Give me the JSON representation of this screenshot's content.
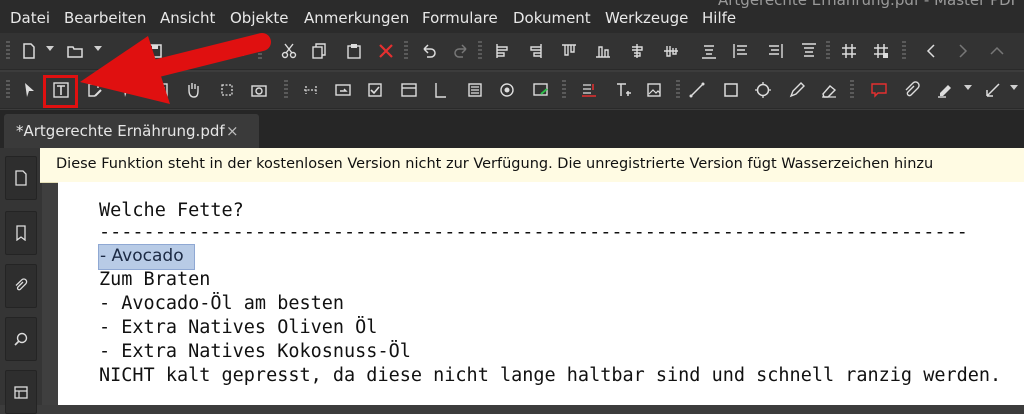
{
  "window_title": "Artgerechte Ernährung.pdf - Master PDF E",
  "menu": [
    "Datei",
    "Bearbeiten",
    "Ansicht",
    "Objekte",
    "Anmerkungen",
    "Formulare",
    "Dokument",
    "Werkzeuge",
    "Hilfe"
  ],
  "toolbar1_icons": [
    "new-document-icon",
    "open-folder-icon",
    "save-icon",
    "print-icon",
    "cut-icon",
    "copy-icon",
    "paste-icon",
    "delete-icon",
    "undo-icon",
    "redo-icon",
    "align-left-icon",
    "align-right-icon",
    "align-top-icon",
    "align-bottom-icon",
    "align-center-h-icon",
    "align-center-v-icon",
    "distribute-h-icon",
    "distribute-v-icon",
    "distribute-h2-icon",
    "distribute-v2-icon",
    "grid-icon",
    "snap-grid-icon",
    "chevron-left-icon",
    "chevron-right-icon",
    "chevron-up-icon",
    "chevron-down-icon"
  ],
  "toolbar2_icons": [
    "select-arrow-icon",
    "edit-text-icon",
    "edit-object-icon",
    "select-object-icon",
    "form-field-icon",
    "hand-tool-icon",
    "crop-icon",
    "snapshot-icon",
    "link-tool-icon",
    "button-field-icon",
    "checkbox-field-icon",
    "combo-field-icon",
    "list-field-icon",
    "list-box-icon",
    "radio-field-icon",
    "signature-field-icon",
    "text-strike-icon",
    "add-text-icon",
    "add-image-icon",
    "line-tool-icon",
    "rectangle-tool-icon",
    "ellipse-tool-icon",
    "pencil-tool-icon",
    "eraser-tool-icon",
    "comment-box-icon",
    "attach-icon",
    "highlighter-icon",
    "arrow-tool-icon"
  ],
  "tab": {
    "label": "*Artgerechte Ernährung.pdf",
    "close": "×"
  },
  "notice": "Diese Funktion steht in der kostenlosen Version nicht zur Verfügung.  Die unregistrierte Version fügt Wasserzeichen hinzu",
  "document": {
    "heading": "Welche Fette?",
    "rule": "------------------------------------------------------------------------------",
    "selected_text": "- Avocado",
    "lines": [
      "Zum Braten",
      "- Avocado-Öl am besten",
      "- Extra Natives Oliven Öl",
      "- Extra Natives Kokosnuss-Öl",
      "NICHT kalt gepresst, da diese nicht lange haltbar sind und schnell ranzig werden."
    ]
  },
  "colors": {
    "annotation_red": "#e01010",
    "selection": "#b8cbe6",
    "notice_bg": "#fffbe3"
  }
}
